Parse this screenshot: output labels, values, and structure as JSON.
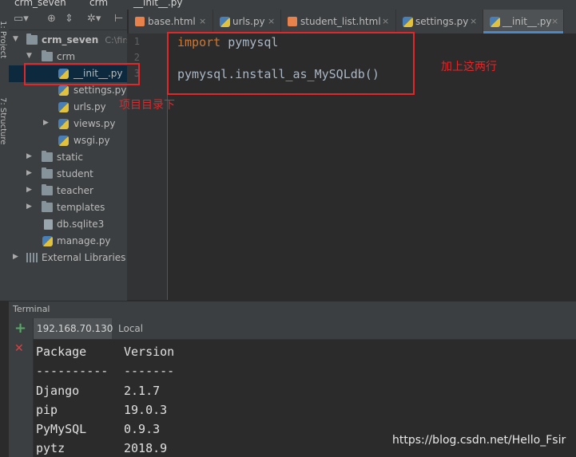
{
  "breadcrumb": {
    "root": "crm_seven",
    "folder": "crm",
    "file": "__init__.py"
  },
  "tool_stripe": {
    "project_label": "1: Project",
    "structure_label": "7: Structure"
  },
  "project_tree": {
    "rows": [
      {
        "label": "crm_seven",
        "extra": "C:\\first"
      },
      {
        "label": "crm"
      },
      {
        "label": "__init__.py"
      },
      {
        "label": "settings.py"
      },
      {
        "label": "urls.py"
      },
      {
        "label": "views.py"
      },
      {
        "label": "wsgi.py"
      },
      {
        "label": "static"
      },
      {
        "label": "student"
      },
      {
        "label": "teacher"
      },
      {
        "label": "templates"
      },
      {
        "label": "db.sqlite3"
      },
      {
        "label": "manage.py"
      },
      {
        "label": "External Libraries"
      }
    ]
  },
  "tabs": [
    {
      "label": "base.html",
      "close": "×"
    },
    {
      "label": "urls.py",
      "close": "×"
    },
    {
      "label": "student_list.html",
      "close": "×"
    },
    {
      "label": "settings.py",
      "close": "×"
    },
    {
      "label": "__init__.py",
      "close": "×"
    }
  ],
  "editor": {
    "line_numbers": [
      "1",
      "2",
      "3"
    ],
    "lines": [
      {
        "keyword": "import",
        "rest": " pymysql"
      },
      {
        "text": ""
      },
      {
        "text": "pymysql.install_as_MySQLdb()"
      }
    ]
  },
  "annotations": {
    "code_note": "加上这两行",
    "tree_note": "项目目录下"
  },
  "terminal": {
    "title": "Terminal",
    "add_icon": "+",
    "close_icon": "✕",
    "tabs": [
      "192.168.70.130",
      "Local"
    ],
    "header": [
      "Package",
      "Version"
    ],
    "separator": [
      "----------",
      "-------"
    ],
    "packages": [
      [
        "Django",
        "2.1.7"
      ],
      [
        "pip",
        "19.0.3"
      ],
      [
        "PyMySQL",
        "0.9.3"
      ],
      [
        "pytz",
        "2018.9"
      ]
    ]
  },
  "watermark": "https://blog.csdn.net/Hello_Fsir",
  "colors": {
    "accent": "#4a88c7",
    "annotation": "#e0272a",
    "keyword": "#cc7832"
  },
  "icons": [
    "folder-icon",
    "python-file-icon",
    "html-file-icon",
    "plus-icon",
    "close-icon",
    "gear-icon",
    "target-icon"
  ]
}
